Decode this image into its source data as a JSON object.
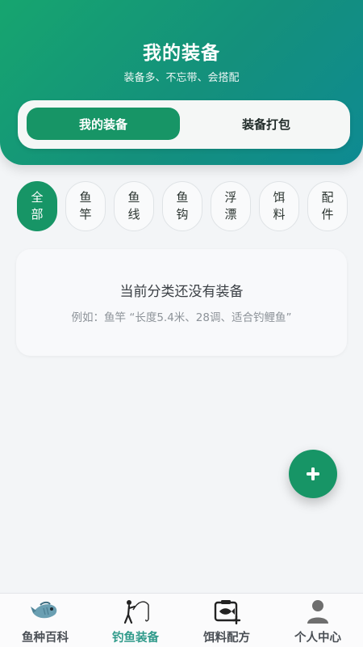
{
  "header": {
    "title": "我的装备",
    "subtitle": "装备多、不忘带、会搭配"
  },
  "segment": {
    "my_gear": "我的装备",
    "packing": "装备打包"
  },
  "categories": [
    "全部",
    "鱼竿",
    "鱼线",
    "鱼钩",
    "浮漂",
    "饵料",
    "配件"
  ],
  "active_category": "全部",
  "empty_state": {
    "title": "当前分类还没有装备",
    "hint": "例如：鱼竿 “长度5.4米、28调、适合钓鲤鱼”"
  },
  "fab": {
    "icon": "plus-icon"
  },
  "tabbar": {
    "items": [
      {
        "label": "鱼种百科",
        "icon": "fish-icon"
      },
      {
        "label": "钓鱼装备",
        "icon": "angler-icon"
      },
      {
        "label": "饵料配方",
        "icon": "bait-box-icon"
      },
      {
        "label": "个人中心",
        "icon": "person-icon"
      }
    ],
    "active": "钓鱼装备"
  },
  "colors": {
    "accent": "#179566",
    "tab_active": "#2f9a8a",
    "header_start": "#16a56f",
    "header_end": "#0e8a92"
  }
}
